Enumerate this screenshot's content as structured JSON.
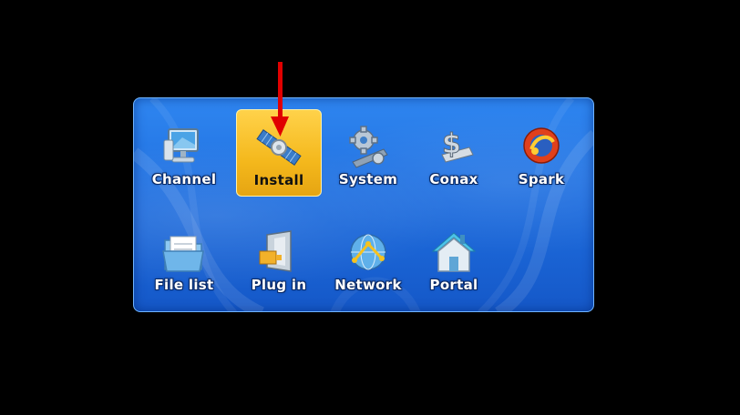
{
  "menu": {
    "selected_index": 1,
    "items": [
      {
        "label": "Channel",
        "icon": "monitor-icon"
      },
      {
        "label": "Install",
        "icon": "satellite-icon"
      },
      {
        "label": "System",
        "icon": "gears-icon"
      },
      {
        "label": "Conax",
        "icon": "dollar-card-icon"
      },
      {
        "label": "Spark",
        "icon": "spark-globe-icon"
      },
      {
        "label": "File list",
        "icon": "folder-icon"
      },
      {
        "label": "Plug in",
        "icon": "plugin-door-icon"
      },
      {
        "label": "Network",
        "icon": "network-globe-icon"
      },
      {
        "label": "Portal",
        "icon": "house-icon"
      }
    ]
  },
  "colors": {
    "background": "#000000",
    "panel": "#1f6fe0",
    "selected": "#f4b81c",
    "arrow": "#e00000"
  }
}
